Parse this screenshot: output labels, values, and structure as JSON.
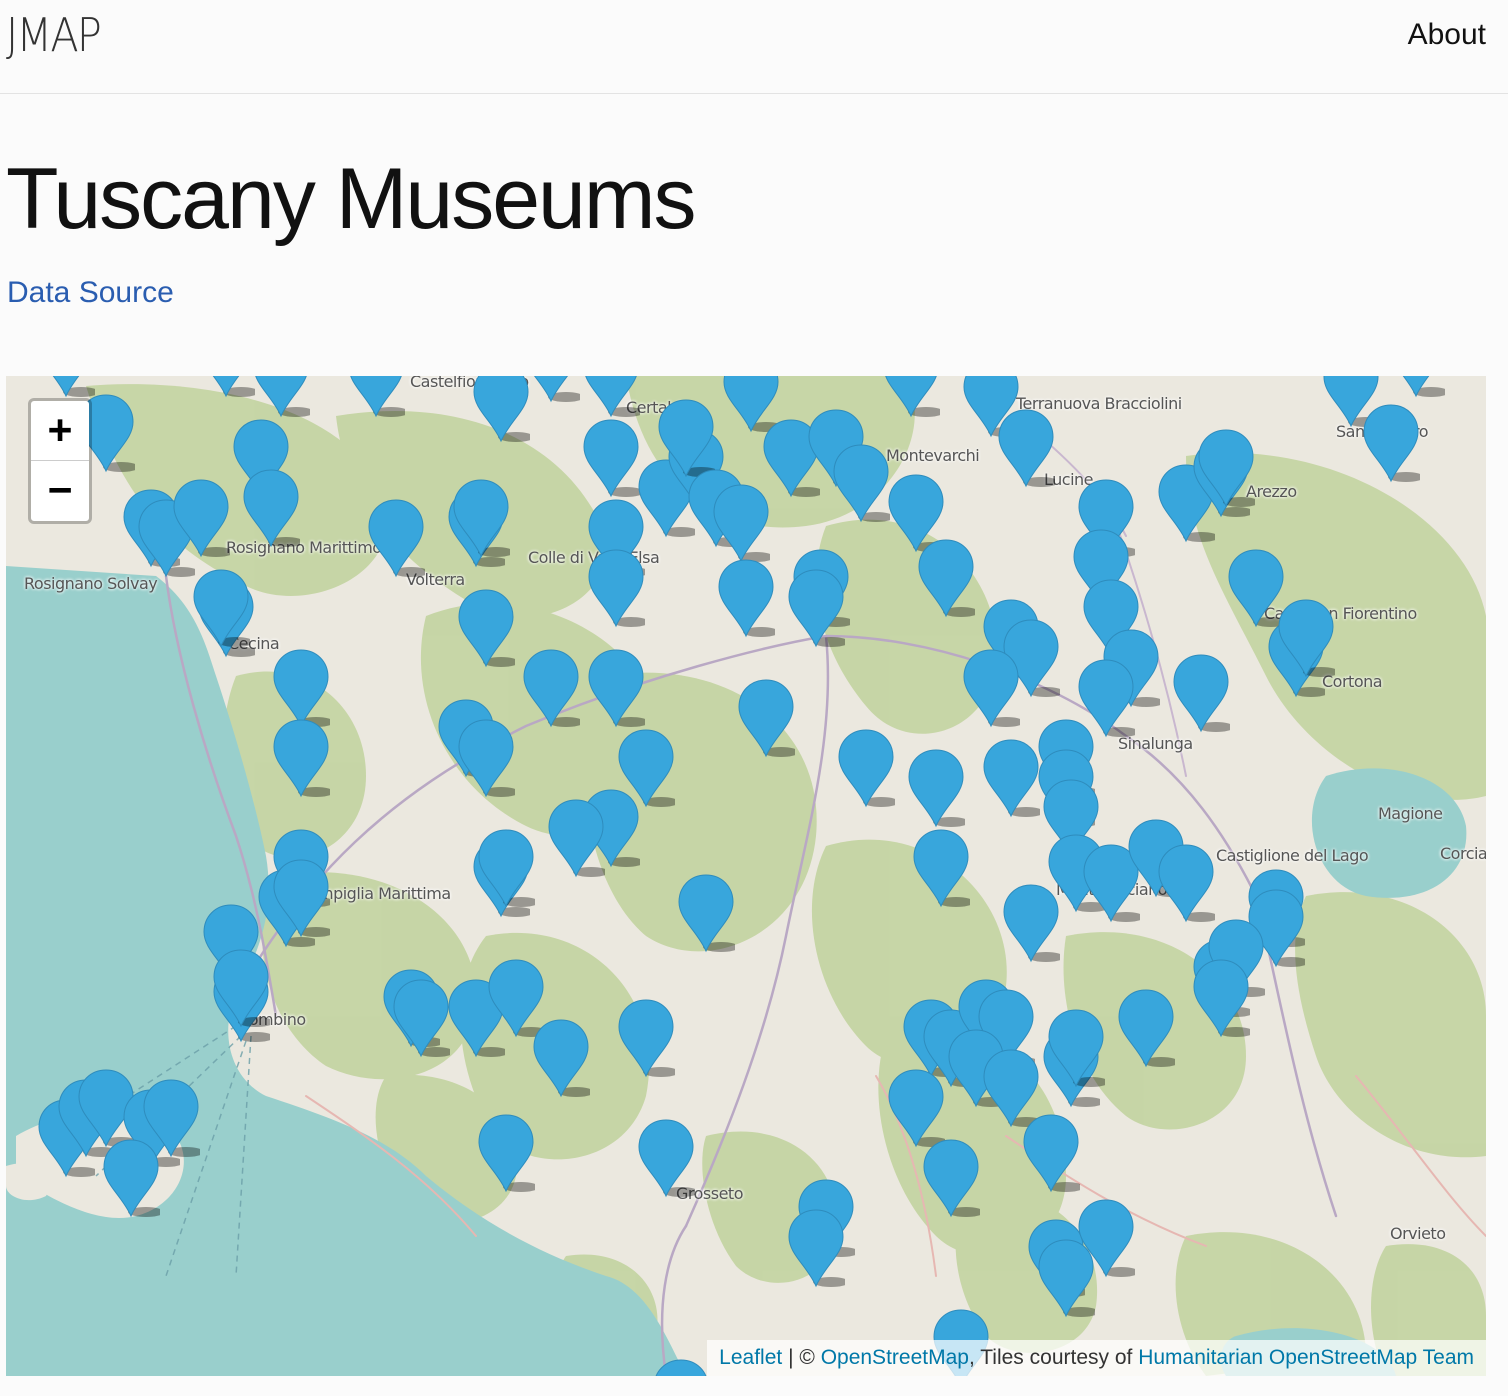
{
  "navbar": {
    "brand": "JMAP",
    "about": "About"
  },
  "page": {
    "title": "Tuscany Museums",
    "data_source_link": "Data Source"
  },
  "map": {
    "zoom_in_label": "+",
    "zoom_out_label": "−",
    "marker_color": "#38a6dc",
    "sea_color": "#99cfcc",
    "forest_color": "#c6d6a4",
    "towns": [
      "Terranuova Bracciolini",
      "Montevarchi",
      "Rosignano Marittimo",
      "Rosignano Solvay",
      "Volterra",
      "Colle di Val d'Elsa",
      "Cecina",
      "Castiglion Fiorentino",
      "Sinalunga",
      "Magione",
      "Castiglione del Lago",
      "Corcia",
      "Campiglia Marittima",
      "Montepulciano",
      "Piombino",
      "Grosseto",
      "Orvieto",
      "Sansepolcro",
      "Arezzo",
      "Lucine",
      "Certaldo",
      "Cortona",
      "Castelfiorentino"
    ],
    "attribution": {
      "leaflet": "Leaflet",
      "sep": "| ©",
      "osm": "OpenStreetMap",
      "tiles": ", Tiles courtesy of",
      "hot": "Humanitarian OpenStreetMap Team"
    }
  }
}
